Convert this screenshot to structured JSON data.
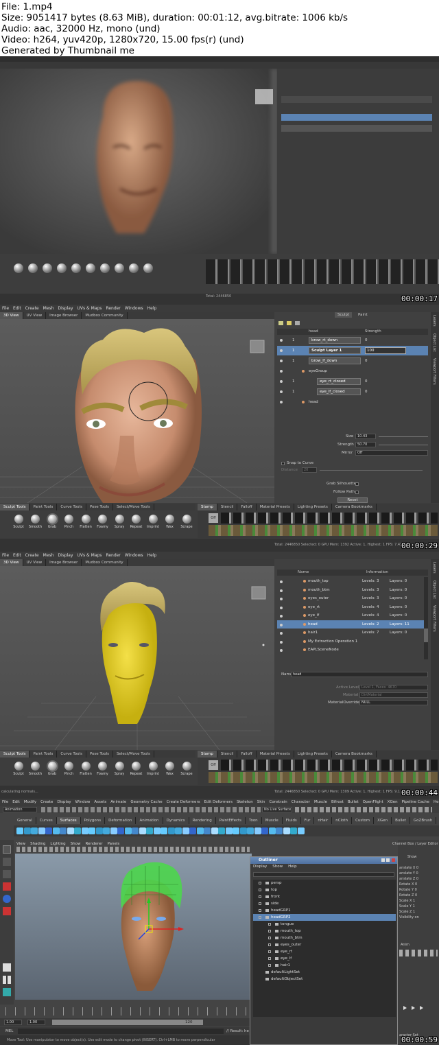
{
  "header": {
    "line1": "File: 1.mp4",
    "line2": "Size: 9051417 bytes (8.63 MiB), duration: 00:01:12, avg.bitrate: 1006 kb/s",
    "line3": "Audio: aac, 32000 Hz, mono (und)",
    "line4": "Video: h264, yuv420p, 1280x720, 15.00 fps(r) (und)",
    "line5": "Generated by Thumbnail me"
  },
  "frames": {
    "f1": {
      "timestamp": "00:00:17"
    },
    "f2": {
      "timestamp": "00:00:29"
    },
    "f3": {
      "timestamp": "00:00:44"
    },
    "f4": {
      "timestamp": "00:00:59"
    }
  },
  "mudbox": {
    "menu": [
      "File",
      "Edit",
      "Create",
      "Mesh",
      "Display",
      "UVs & Maps",
      "Render",
      "Windows",
      "Help"
    ],
    "view_tabs": [
      "3D View",
      "UV View",
      "Image Browser",
      "Mudbox Community"
    ],
    "tray_tabs": [
      "Sculpt Tools",
      "Paint Tools",
      "Curve Tools",
      "Pose Tools",
      "Select/Move Tools"
    ],
    "tools": [
      "Sculpt",
      "Smooth",
      "Grab",
      "Pinch",
      "Flatten",
      "Foamy",
      "Spray",
      "Repeat",
      "Imprint",
      "Wax",
      "Scrape"
    ],
    "stamp_tabs": [
      "Stamp",
      "Stencil",
      "Falloff",
      "Material Presets",
      "Lighting Presets",
      "Camera Bookmarks"
    ],
    "stamp_off": "Off",
    "side_tabs": [
      "Layers",
      "Object List",
      "Viewport Filters"
    ],
    "f2_layers": {
      "tab_sculpt": "Sculpt",
      "tab_paint": "Paint",
      "header_name": "head",
      "header_strength": "Strength",
      "rows": [
        {
          "n": "1",
          "name": "brow_rt_down",
          "val": "0"
        },
        {
          "n": "1",
          "name": "Sculpt Layer 1",
          "val": "100"
        },
        {
          "n": "1",
          "name": "brow_lf_down",
          "val": "0"
        },
        {
          "n": "",
          "name": "eyeGroup",
          "val": ""
        },
        {
          "n": "1",
          "name": "eye_rt_closed",
          "val": "0"
        },
        {
          "n": "1",
          "name": "eye_lf_closed",
          "val": "0"
        },
        {
          "n": "",
          "name": "head",
          "val": ""
        }
      ],
      "size_label": "Size",
      "size_value": "10.43",
      "strength_label": "Strength",
      "strength_value": "50.70",
      "mirror_label": "Mirror",
      "mirror_value": "Off",
      "snap_label": "Snap to Curve",
      "distance_label": "Distance",
      "distance_value": "20",
      "grab_silhouette": "Grab Silhouette",
      "follow_path": "Follow Path",
      "reset": "Reset"
    },
    "f2_status": "Total: 2446850  Selected: 0  GPU Mem: 1392  Active: 1, Highest: 1  FPS: 7.436",
    "f3_objects": {
      "col_name": "Name",
      "col_info": "Information",
      "rows": [
        {
          "name": "mouth_top",
          "levels": "Levels: 3",
          "layers": "Layers: 0"
        },
        {
          "name": "mouth_btm",
          "levels": "Levels: 3",
          "layers": "Layers: 0"
        },
        {
          "name": "eyes_outer",
          "levels": "Levels: 3",
          "layers": "Layers: 0"
        },
        {
          "name": "eye_rt",
          "levels": "Levels: 4",
          "layers": "Layers: 0"
        },
        {
          "name": "eye_lf",
          "levels": "Levels: 4",
          "layers": "Layers: 0"
        },
        {
          "name": "head",
          "levels": "Levels: 2",
          "layers": "Layers: 11"
        },
        {
          "name": "hair1",
          "levels": "Levels: 7",
          "layers": "Layers: 0"
        },
        {
          "name": "My Extraction Operation 1",
          "levels": "",
          "layers": ""
        },
        {
          "name": "EAPLSceneNode",
          "levels": "",
          "layers": ""
        }
      ],
      "name_label": "Name",
      "name_value": "head",
      "active_level": "Active Level",
      "active_level_value": "Level 1, Faces: 4670",
      "material": "Material",
      "material_value": "DirtMaterial",
      "material_override": "MaterialOverride",
      "material_override_value": "NULL"
    },
    "f3_left_status": "calculating normals...",
    "f3_status": "Total: 2446850  Selected: 0  GPU Mem: 1309  Active: 1, Highest: 1  FPS: 9.1",
    "f1_status": "Total: 2446850"
  },
  "maya": {
    "menu": [
      "File",
      "Edit",
      "Modify",
      "Create",
      "Display",
      "Window",
      "Assets",
      "Animate",
      "Geometry Cache",
      "Create Deformers",
      "Edit Deformers",
      "Skeleton",
      "Skin",
      "Constrain",
      "Character",
      "Muscle",
      "Bifrost",
      "Bullet",
      "OpenFlight",
      "XGen",
      "Pipeline Cache",
      "Help"
    ],
    "mode": "Animation",
    "no_live": "No Live Surface",
    "shelf_tabs": [
      "General",
      "Curves",
      "Surfaces",
      "Polygons",
      "Deformation",
      "Animation",
      "Dynamics",
      "Rendering",
      "PaintEffects",
      "Toon",
      "Muscle",
      "Fluids",
      "Fur",
      "nHair",
      "nCloth",
      "Custom",
      "XGen",
      "Bullet",
      "GoZBrush",
      "TURTLE"
    ],
    "panel_menu": [
      "View",
      "Shading",
      "Lighting",
      "Show",
      "Renderer",
      "Panels"
    ],
    "outliner": {
      "title": "Outliner",
      "menu": [
        "Display",
        "Show",
        "Help"
      ],
      "items": [
        "persp",
        "top",
        "front",
        "side",
        "headGRP1",
        "headGRP2",
        "tongue",
        "mouth_top",
        "mouth_btm",
        "eyes_outer",
        "eye_rt",
        "eye_lf",
        "hair1",
        "defaultLightSet",
        "defaultObjectSet"
      ]
    },
    "channel_box": {
      "title": "Channel Box / Layer Editor",
      "tab": "Show",
      "rows": [
        "anslate X 0",
        "anslate Y 0",
        "anslate Z 0",
        "Rotate X 0",
        "Rotate Y 0",
        "Rotate Z 0",
        "Scale X 1",
        "Scale Y 1",
        "Scale Z 1",
        "Visibility on"
      ],
      "anim": "Anim",
      "char_set": "aracter Set"
    },
    "timeline": {
      "start": "1.00",
      "start2": "1.00",
      "end": "120",
      "mel": "MEL",
      "result": "// Result: he"
    },
    "help_line": "Move Tool: Use manipulator to move object(s). Use edit mode to change pivot (INSERT).  Ctrl+LMB to move perpendicular"
  }
}
